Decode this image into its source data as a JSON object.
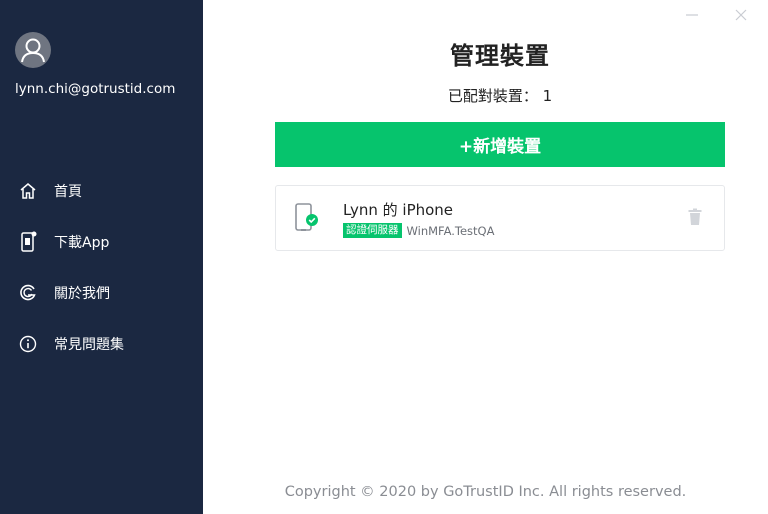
{
  "window": {
    "minimize_icon": "minimize-icon",
    "close_icon": "close-icon"
  },
  "sidebar": {
    "user_email": "lynn.chi@gotrustid.com",
    "items": [
      {
        "label": "首頁",
        "icon": "home-icon"
      },
      {
        "label": "下載App",
        "icon": "phone-download-icon"
      },
      {
        "label": "關於我們",
        "icon": "gotrustid-logo-icon"
      },
      {
        "label": "常見問題集",
        "icon": "info-icon"
      }
    ]
  },
  "main": {
    "title": "管理裝置",
    "paired_count_text": "已配對裝置： 1",
    "add_device_label": "+新增裝置",
    "devices": [
      {
        "name": "Lynn 的 iPhone",
        "badge": "認證伺服器",
        "server": "WinMFA.TestQA"
      }
    ]
  },
  "footer": {
    "copyright": "Copyright © 2020 by GoTrustID Inc. All rights reserved."
  },
  "colors": {
    "sidebar_bg": "#1b2841",
    "accent_green": "#06c46d",
    "text_dark": "#222222",
    "text_muted": "#8a8d93"
  }
}
